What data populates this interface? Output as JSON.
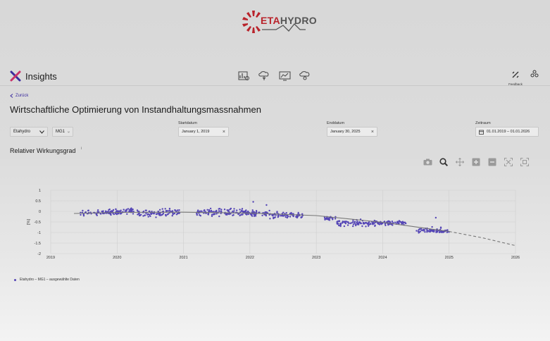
{
  "logo": {
    "brand_eta": "ETA",
    "brand_hydro": "HYDRO"
  },
  "header": {
    "app_title": "Insights",
    "nav": [
      "chart-report-icon",
      "cloud-tree-icon",
      "monitor-chart-icon",
      "cloud-cog-icon"
    ],
    "feedback_label": "Feedback"
  },
  "back_link": "Zurück",
  "page_title": "Wirtschaftliche Optimierung von Instandhaltungsmassnahmen",
  "filters": {
    "plant": "Etahydro",
    "unit": "MG1",
    "start_label": "Startdatum",
    "start_value": "January 1, 2019",
    "end_label": "Enddatum",
    "end_value": "January 30, 2025",
    "range_label": "Zeitraum",
    "range_value": "01.01.2019 – 01.01.2026"
  },
  "section_title": "Relativer Wirkungsgrad",
  "info_mark": "i",
  "toolbar": [
    "camera-icon",
    "zoom-icon",
    "pan-icon",
    "zoom-in-icon",
    "zoom-out-icon",
    "autoscale-icon",
    "reset-axes-icon"
  ],
  "colors": {
    "accent": "#3b2c9e",
    "points": "#5546b6",
    "trend": "#777777",
    "logo_red": "#b9232b"
  },
  "chart_data": {
    "type": "scatter",
    "ylabel": "[%]",
    "xlim": [
      2019,
      2026
    ],
    "ylim": [
      -2,
      1
    ],
    "x_ticks": [
      "2019",
      "2020",
      "2021",
      "2022",
      "2023",
      "2024",
      "2025",
      "2026"
    ],
    "y_ticks": [
      "1",
      "0.5",
      "0",
      "-0.5",
      "-1",
      "-1.5",
      "-2"
    ],
    "legend": "Etahydro – MG1 – ausgewählte Daten",
    "grid": true,
    "clusters": [
      {
        "x_start": 2019.45,
        "x_end": 2020.05,
        "y_mean": -0.05,
        "y_spread": 0.12
      },
      {
        "x_start": 2020.05,
        "x_end": 2020.25,
        "y_mean": 0.02,
        "y_spread": 0.12
      },
      {
        "x_start": 2020.3,
        "x_end": 2020.6,
        "y_mean": -0.1,
        "y_spread": 0.15
      },
      {
        "x_start": 2020.6,
        "x_end": 2020.95,
        "y_mean": -0.05,
        "y_spread": 0.15
      },
      {
        "x_start": 2021.2,
        "x_end": 2021.7,
        "y_mean": -0.05,
        "y_spread": 0.15
      },
      {
        "x_start": 2021.7,
        "x_end": 2022.0,
        "y_mean": -0.05,
        "y_spread": 0.15
      },
      {
        "x_start": 2022.0,
        "x_end": 2022.3,
        "y_mean": -0.1,
        "y_spread": 0.12
      },
      {
        "x_start": 2022.3,
        "x_end": 2022.8,
        "y_mean": -0.2,
        "y_spread": 0.15
      },
      {
        "x_start": 2023.1,
        "x_end": 2023.3,
        "y_mean": -0.35,
        "y_spread": 0.1
      },
      {
        "x_start": 2023.3,
        "x_end": 2023.9,
        "y_mean": -0.55,
        "y_spread": 0.15
      },
      {
        "x_start": 2023.9,
        "x_end": 2024.35,
        "y_mean": -0.55,
        "y_spread": 0.1
      },
      {
        "x_start": 2024.5,
        "x_end": 2024.9,
        "y_mean": -0.9,
        "y_spread": 0.12
      },
      {
        "x_start": 2024.9,
        "x_end": 2025.0,
        "y_mean": -0.95,
        "y_spread": 0.08
      }
    ],
    "outliers": [
      [
        2022.05,
        0.45
      ],
      [
        2022.25,
        0.3
      ],
      [
        2024.8,
        -0.3
      ]
    ],
    "trend_fit": [
      [
        2019.35,
        -0.1
      ],
      [
        2020,
        -0.05
      ],
      [
        2021,
        -0.04
      ],
      [
        2022,
        -0.08
      ],
      [
        2023,
        -0.2
      ],
      [
        2024,
        -0.52
      ],
      [
        2025,
        -0.95
      ]
    ],
    "trend_forecast": [
      [
        2025,
        -0.95
      ],
      [
        2025.5,
        -1.25
      ],
      [
        2026,
        -1.62
      ]
    ]
  }
}
